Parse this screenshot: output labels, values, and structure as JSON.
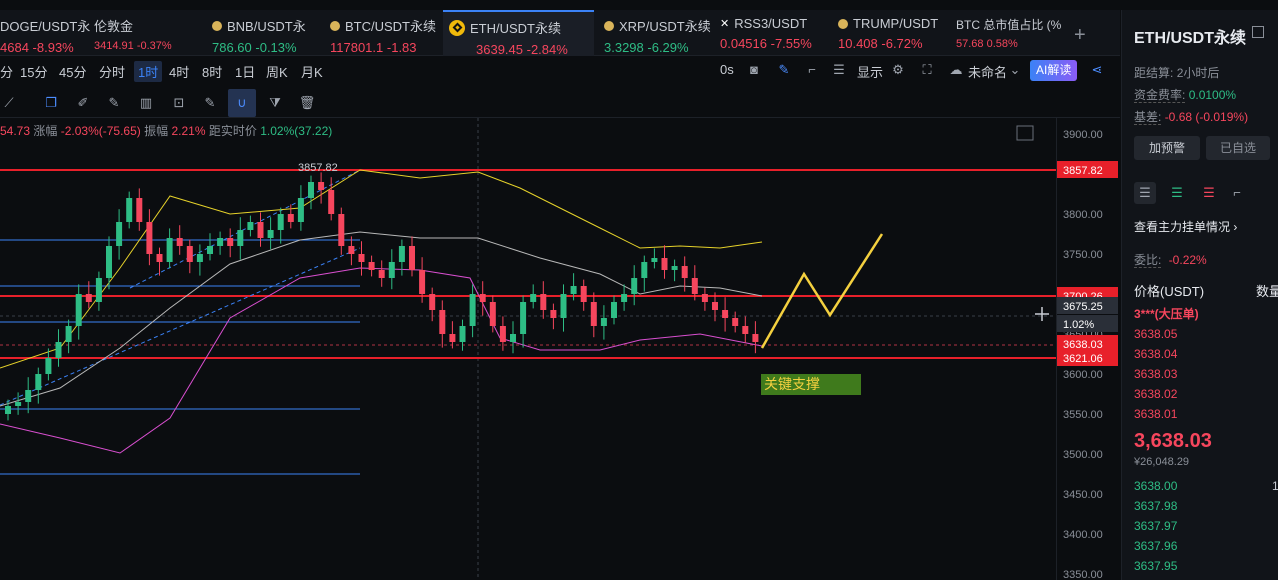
{
  "tickers": [
    {
      "name": "DOGE/USDT永",
      "price": "4684",
      "change": "-8.93%",
      "dir": "down",
      "icon": "none"
    },
    {
      "name": "伦敦金",
      "price": "3414.91",
      "change": "-0.37%",
      "dir": "down",
      "icon": "none",
      "small": true
    },
    {
      "name": "BNB/USDT永",
      "price": "786.60",
      "change": "-0.13%",
      "dir": "up",
      "icon": "coin-dot"
    },
    {
      "name": "BTC/USDT永续",
      "price": "117801.1",
      "change": "-1.83",
      "dir": "down",
      "icon": "coin-dot"
    },
    {
      "name": "ETH/USDT永续",
      "price": "3639.45",
      "change": "-2.84%",
      "dir": "down",
      "icon": "exchange-logo",
      "active": true
    },
    {
      "name": "XRP/USDT永续",
      "price": "3.3298",
      "change": "-6.29%",
      "dir": "up",
      "icon": "coin-dot"
    },
    {
      "name": "RSS3/USDT",
      "price": "0.04516",
      "change": "-7.55%",
      "dir": "down",
      "icon": "x-mark"
    },
    {
      "name": "TRUMP/USDT",
      "price": "10.408",
      "change": "-6.72%",
      "dir": "down",
      "icon": "coin-dot"
    },
    {
      "name": "BTC 总市值占比 (%",
      "price": "57.68",
      "change": "0.58%",
      "dir": "down",
      "icon": "none",
      "small": true
    }
  ],
  "add_tab_label": "+",
  "intervals": [
    "分",
    "15分",
    "45分",
    "分时",
    "1时",
    "4时",
    "8时",
    "1日",
    "周K",
    "月K"
  ],
  "active_interval": "1时",
  "toolbar": {
    "countdown": "0s",
    "display_label": "显示",
    "unnamed_label": "未命名",
    "ai_label": "AI解读"
  },
  "indicator_line": {
    "open_frag": "54.73",
    "change_label": "涨幅",
    "change_value": "-2.03%(-75.65)",
    "amplitude_label": "振幅",
    "amplitude_value": "2.21%",
    "distance_label": "距实时价",
    "distance_value": "1.02%(37.22)"
  },
  "price_axis": {
    "ticks": [
      "3900.00",
      "3850.00",
      "3800.00",
      "3750.00",
      "3700.00",
      "3650.00",
      "3600.00",
      "3550.00",
      "3500.00",
      "3450.00",
      "3400.00",
      "3350.00"
    ],
    "labels": [
      {
        "text": "3857.82",
        "style": "red"
      },
      {
        "text": "3700.26",
        "style": "red"
      },
      {
        "text": "3675.25",
        "style": "grey"
      },
      {
        "text": "1.02%",
        "style": "grey"
      },
      {
        "text": "3638.03",
        "style": "red"
      },
      {
        "text": "3621.06",
        "style": "red"
      }
    ]
  },
  "chart": {
    "high_label": "3857.82",
    "annotation": "关键支撑",
    "colors": {
      "up": "#2ebd85",
      "down": "#f6465d",
      "boll_upper": "#e6d22a",
      "boll_mid": "#b8b8b8",
      "boll_lower": "#d94fd0",
      "forecast": "#f4d03f",
      "annotation_bg": "#3f7a1c",
      "annotation_text": "#f4d03f"
    }
  },
  "right_panel": {
    "title": "ETH/USDT永续",
    "settlement_label": "距结算:",
    "settlement_value": "2小时后",
    "funding_label": "资金费率:",
    "funding_value": "0.0100%",
    "basis_label": "基差:",
    "basis_value": "-0.68 (-0.019%)",
    "alert_button": "加预警",
    "watch_button": "已自选",
    "main_orders_label": "查看主力挂单情况",
    "ratio_label": "委比:",
    "ratio_value": "-0.22%",
    "price_header": "价格(USDT)",
    "qty_header": "数量 (",
    "big_wall": "3***(大压单)",
    "asks": [
      "3638.05",
      "3638.04",
      "3638.03",
      "3638.02",
      "3638.01"
    ],
    "last_price": "3,638.03",
    "last_fiat": "¥26,048.29",
    "bids": [
      "3638.00",
      "3637.98",
      "3637.97",
      "3637.96",
      "3637.95"
    ],
    "bid_first_qty": "1"
  }
}
